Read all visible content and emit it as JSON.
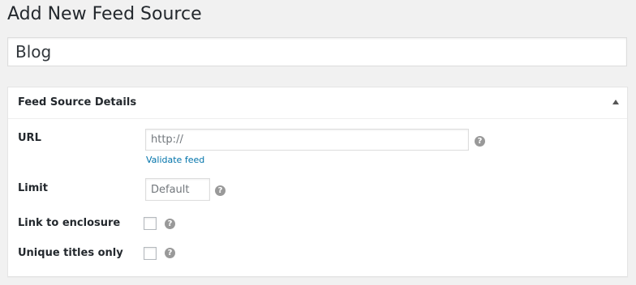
{
  "page": {
    "title": "Add New Feed Source"
  },
  "post_title": {
    "value": "Blog"
  },
  "metabox": {
    "title": "Feed Source Details",
    "toggle_icon": "triangle-up-icon",
    "fields": {
      "url": {
        "label": "URL",
        "value": "",
        "placeholder": "http://",
        "help_icon": "question-circle-icon",
        "link_text": "Validate feed"
      },
      "limit": {
        "label": "Limit",
        "value": "",
        "placeholder": "Default",
        "help_icon": "question-circle-icon"
      },
      "link_to_enclosure": {
        "label": "Link to enclosure",
        "checked": false,
        "help_icon": "question-circle-icon"
      },
      "unique_titles_only": {
        "label": "Unique titles only",
        "checked": false,
        "help_icon": "question-circle-icon"
      }
    }
  },
  "colors": {
    "background": "#f1f1f1",
    "link": "#0073aa",
    "help_icon": "#999999",
    "border": "#dddddd"
  }
}
